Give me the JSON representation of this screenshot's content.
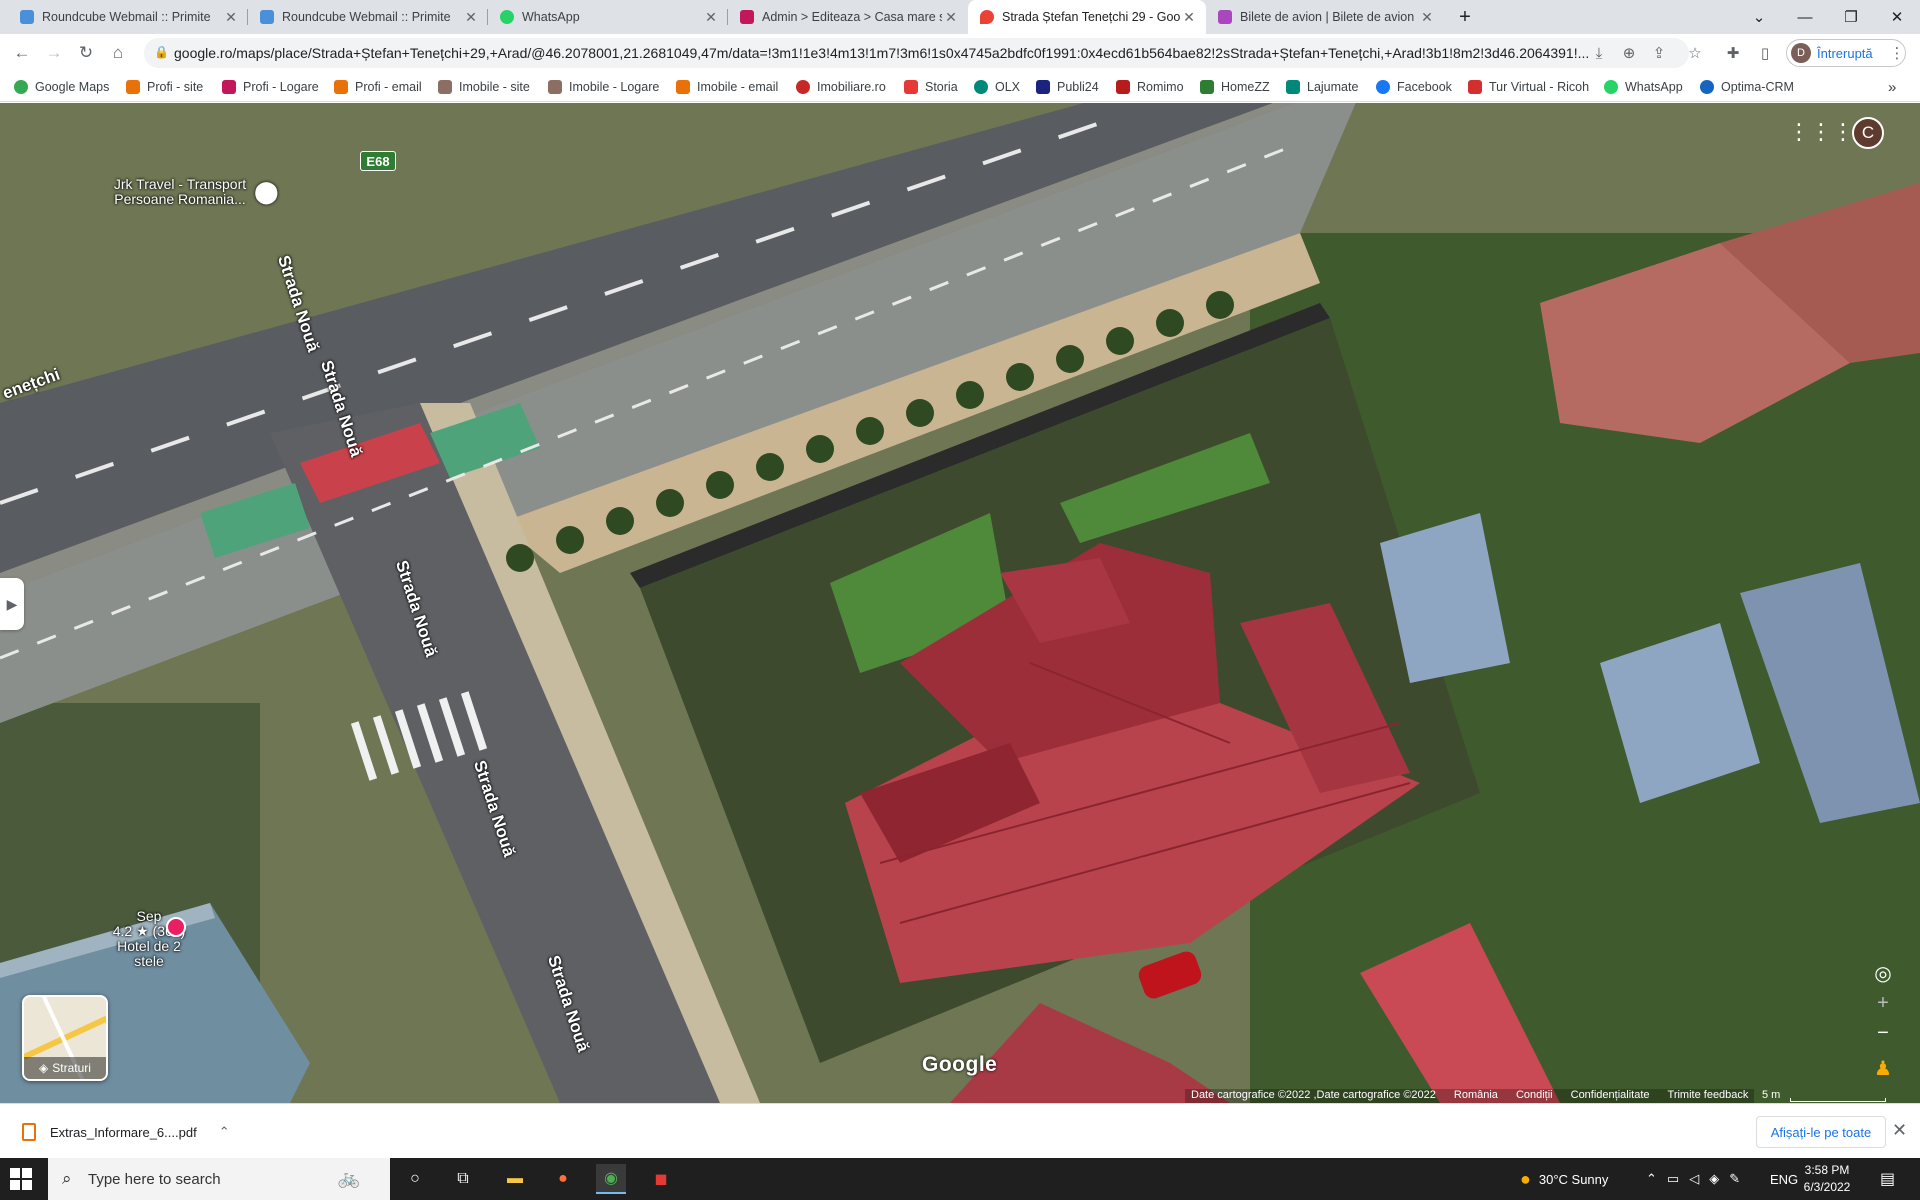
{
  "tabs": [
    {
      "title": "Roundcube Webmail :: Primite",
      "icon": "roundcube-icon",
      "active": false
    },
    {
      "title": "Roundcube Webmail :: Primite",
      "icon": "roundcube-icon",
      "active": false
    },
    {
      "title": "WhatsApp",
      "icon": "whatsapp-icon",
      "active": false
    },
    {
      "title": "Admin > Editeaza > Casa mare st",
      "icon": "t-icon",
      "active": false
    },
    {
      "title": "Strada Ștefan Tenețchi 29 - Goog",
      "icon": "maps-pin-icon",
      "active": true
    },
    {
      "title": "Bilete de avion | Bilete de avion ie",
      "icon": "w-icon",
      "active": false
    }
  ],
  "new_tab_glyph": "+",
  "window": {
    "dropdown": "⌄",
    "minimize": "—",
    "restore": "❐",
    "close": "✕"
  },
  "toolbar": {
    "url": "google.ro/maps/place/Strada+Ștefan+Tenețchi+29,+Arad/@46.2078001,21.2681049,47m/data=!3m1!1e3!4m13!1m7!3m6!1s0x4745a2bdfc0f1991:0x4ecd61b564bae82!2sStrada+Ștefan+Tenețchi,+Arad!3b1!8m2!3d46.2064391!...",
    "profile_initial": "D",
    "profile_label": "Întreruptă"
  },
  "bookmarks": [
    {
      "label": "Google Maps",
      "color": "#34a853"
    },
    {
      "label": "Profi - site",
      "color": "#e8710a"
    },
    {
      "label": "Profi - Logare",
      "color": "#c2185b"
    },
    {
      "label": "Profi - email",
      "color": "#e8710a"
    },
    {
      "label": "Imobile - site",
      "color": "#8d6e63"
    },
    {
      "label": "Imobile - Logare",
      "color": "#8d6e63"
    },
    {
      "label": "Imobile - email",
      "color": "#e8710a"
    },
    {
      "label": "Imobiliare.ro",
      "color": "#c62828"
    },
    {
      "label": "Storia",
      "color": "#e53935"
    },
    {
      "label": "OLX",
      "color": "#00897b"
    },
    {
      "label": "Publi24",
      "color": "#1a237e"
    },
    {
      "label": "Romimo",
      "color": "#b71c1c"
    },
    {
      "label": "HomeZZ",
      "color": "#2e7d32"
    },
    {
      "label": "Lajumate",
      "color": "#00897b"
    },
    {
      "label": "Facebook",
      "color": "#1877f2"
    },
    {
      "label": "Tur Virtual - Ricoh",
      "color": "#d32f2f"
    },
    {
      "label": "WhatsApp",
      "color": "#25d366"
    },
    {
      "label": "Optima-CRM",
      "color": "#1565c0"
    }
  ],
  "bookmarks_more": "»",
  "map": {
    "road_badge": "E68",
    "street_labels": [
      "enețchi",
      "Strada Nouă",
      "Strada Nouă",
      "Strada Nouă",
      "Strada Nouă",
      "Strada Nouă"
    ],
    "poi_travel": "Jrk Travel - Transport Persoane Romania...",
    "poi_hotel_name": "Sep",
    "poi_hotel_rating": "4.2 ★ (361)",
    "poi_hotel_type": "Hotel de 2 stele",
    "account_initial": "C",
    "layers_label": "Straturi",
    "logo": "Google",
    "attribution": [
      "Date cartografice ©2022 ,Date cartografice ©2022",
      "România",
      "Condiții",
      "Confidențialitate",
      "Trimite feedback"
    ],
    "scale": "5 m"
  },
  "download": {
    "filename": "Extras_Informare_6....pdf",
    "show_all": "Afișați-le pe toate"
  },
  "taskbar": {
    "search_placeholder": "Type here to search",
    "weather": "30°C  Sunny",
    "lang": "ENG",
    "time": "3:58 PM",
    "date": "6/3/2022"
  }
}
